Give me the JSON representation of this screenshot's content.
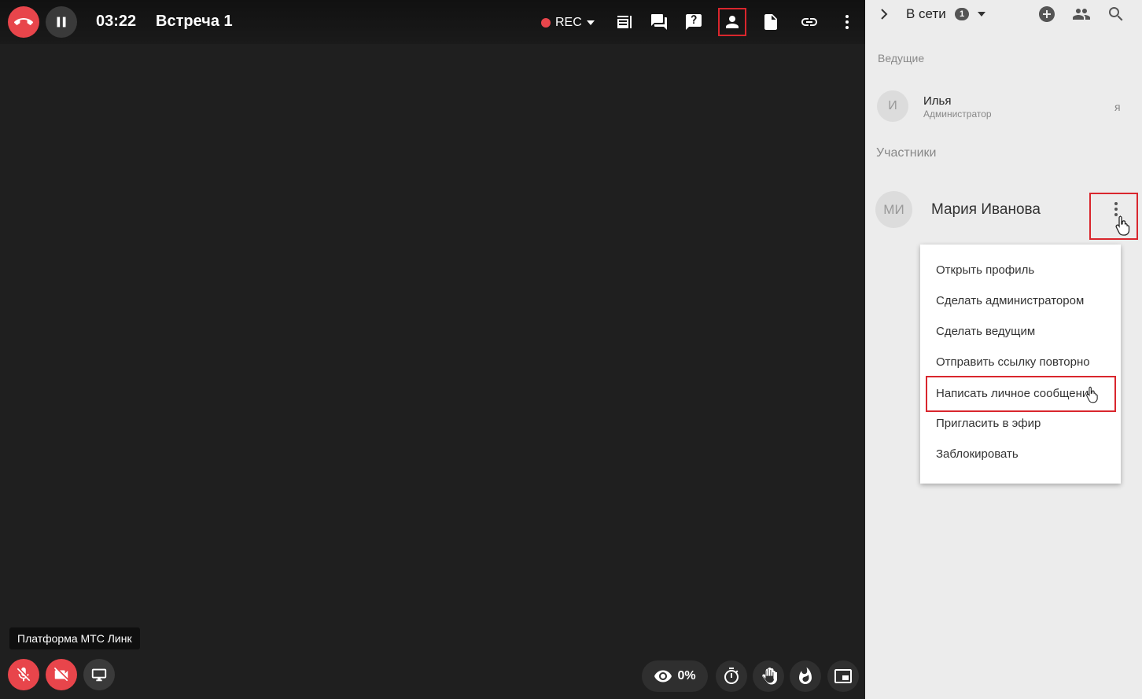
{
  "meeting": {
    "timer": "03:22",
    "title": "Встреча 1",
    "rec_label": "REC"
  },
  "colors": {
    "accent_red": "#e8454b",
    "highlight_border": "#d9262d",
    "panel_bg": "#ececec",
    "stage_bg": "#1f1f1f"
  },
  "toolbar_icons": [
    "notes-icon",
    "chat-icon",
    "question-icon",
    "participants-icon",
    "document-icon",
    "link-icon",
    "more-vertical-icon"
  ],
  "bottom": {
    "tooltip": "Платформа МТС Линк",
    "views_percent": "0%"
  },
  "panel": {
    "online_label": "В сети",
    "online_count": "1",
    "hosts_title": "Ведущие",
    "members_title": "Участники",
    "hosts": [
      {
        "initials": "И",
        "name": "Илья",
        "role": "Администратор",
        "me_label": "я"
      }
    ],
    "members": [
      {
        "initials": "МИ",
        "name": "Мария Иванова"
      }
    ]
  },
  "context_menu": {
    "items": [
      "Открыть профиль",
      "Сделать администратором",
      "Сделать ведущим",
      "Отправить ссылку повторно",
      "Написать личное сообщение",
      "Пригласить в эфир",
      "Заблокировать"
    ]
  }
}
